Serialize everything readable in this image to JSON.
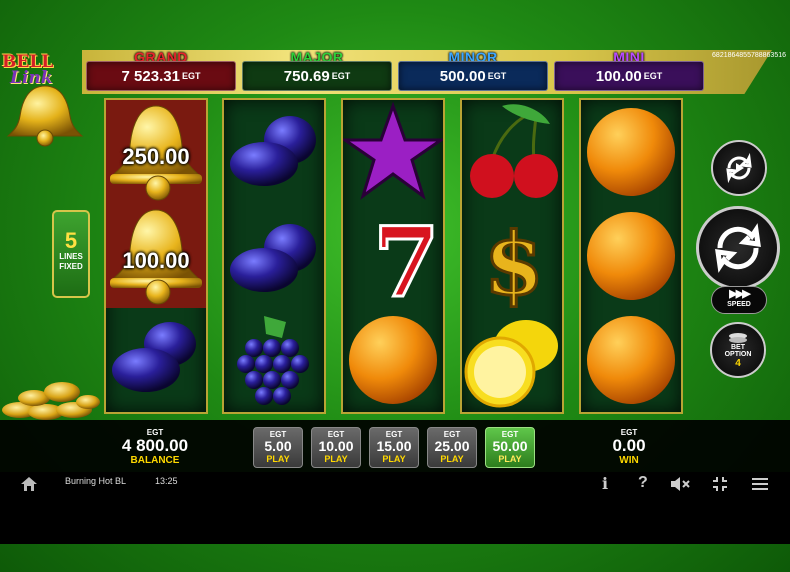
{
  "logo": {
    "line1": "BELL",
    "line2": "Link"
  },
  "session_id": "6821864855788863516",
  "jackpots": [
    {
      "label": "GRAND",
      "value": "7 523.31",
      "currency": "EGT",
      "label_color": "#e8232c",
      "box_color": "#6a0b12"
    },
    {
      "label": "MAJOR",
      "value": "750.69",
      "currency": "EGT",
      "label_color": "#2fd13a",
      "box_color": "#0f3a12"
    },
    {
      "label": "MINOR",
      "value": "500.00",
      "currency": "EGT",
      "label_color": "#3ba6ff",
      "box_color": "#0a2a5a"
    },
    {
      "label": "MINI",
      "value": "100.00",
      "currency": "EGT",
      "label_color": "#b84bff",
      "box_color": "#3a0f5a"
    }
  ],
  "lines": {
    "count": "5",
    "label1": "LINES",
    "label2": "FIXED"
  },
  "reels": [
    [
      {
        "symbol": "bell",
        "value": "250.00"
      },
      {
        "symbol": "bell",
        "value": "100.00"
      },
      {
        "symbol": "plum"
      }
    ],
    [
      {
        "symbol": "plum"
      },
      {
        "symbol": "plum"
      },
      {
        "symbol": "grapes"
      }
    ],
    [
      {
        "symbol": "star"
      },
      {
        "symbol": "seven"
      },
      {
        "symbol": "orange"
      }
    ],
    [
      {
        "symbol": "cherries"
      },
      {
        "symbol": "dollar"
      },
      {
        "symbol": "lemon"
      }
    ],
    [
      {
        "symbol": "orange"
      },
      {
        "symbol": "orange"
      },
      {
        "symbol": "orange"
      }
    ]
  ],
  "controls": {
    "speed_label": "SPEED",
    "speed_icon": "▶▶▶",
    "bet_option_label1": "BET",
    "bet_option_label2": "OPTION",
    "bet_option_value": "4"
  },
  "balance": {
    "currency": "EGT",
    "value": "4 800.00",
    "label": "BALANCE"
  },
  "bets": [
    {
      "currency": "EGT",
      "value": "5.00",
      "label": "PLAY",
      "selected": false
    },
    {
      "currency": "EGT",
      "value": "10.00",
      "label": "PLAY",
      "selected": false
    },
    {
      "currency": "EGT",
      "value": "15.00",
      "label": "PLAY",
      "selected": false
    },
    {
      "currency": "EGT",
      "value": "25.00",
      "label": "PLAY",
      "selected": false
    },
    {
      "currency": "EGT",
      "value": "50.00",
      "label": "PLAY",
      "selected": true
    }
  ],
  "win": {
    "currency": "EGT",
    "value": "0.00",
    "label": "WIN"
  },
  "status_bar": {
    "game_name": "Burning Hot BL",
    "time": "13:25",
    "info_icon": "i",
    "help_icon": "?",
    "mute_icon": "mute-icon",
    "fullscreen_icon": "fullscreen-icon",
    "menu_icon": "menu-icon"
  }
}
